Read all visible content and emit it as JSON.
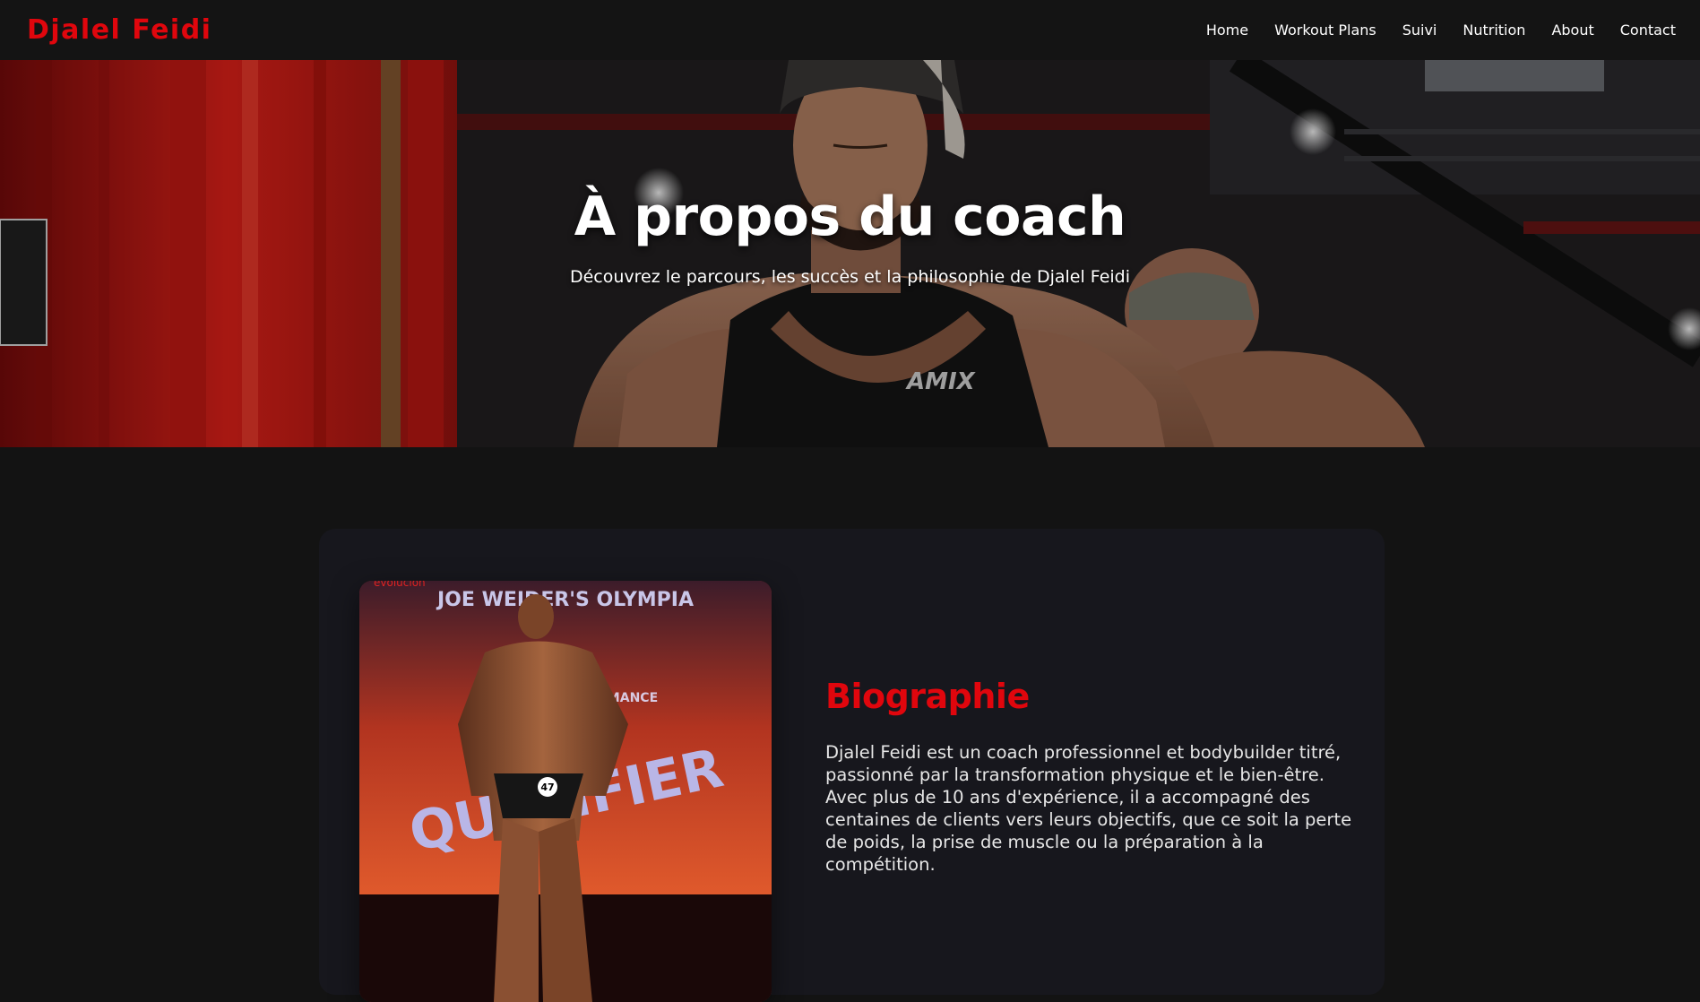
{
  "navbar": {
    "logo": "Djalel Feidi",
    "links": [
      {
        "label": "Home"
      },
      {
        "label": "Workout Plans"
      },
      {
        "label": "Suivi"
      },
      {
        "label": "Nutrition"
      },
      {
        "label": "About"
      },
      {
        "label": "Contact"
      }
    ]
  },
  "hero": {
    "title": "À propos du coach",
    "subtitle": "Découvrez le parcours, les succès et la philosophie de Djalel Feidi",
    "shirt_logo": "AMIX"
  },
  "biography": {
    "heading": "Biographie",
    "paragraph": "Djalel Feidi est un coach professionnel et bodybuilder titré, passionné par la transformation physique et le bien-être. Avec plus de 10 ans d'expérience, il a accompagné des centaines de clients vers leurs objectifs, que ce soit la perte de poids, la prise de muscle ou la préparation à la compétition.",
    "photo_banner_text": "JOE WEIDER'S OLYMPIA",
    "photo_banner_sub": "FITNESS & PERFORMANCE",
    "photo_banner_text2": "QUALIFIER",
    "photo_corner_text": "evolución",
    "competitor_number": "47"
  },
  "colors": {
    "accent": "#e0060d",
    "background": "#131313",
    "card": "#17171d",
    "nav": "#141414"
  }
}
